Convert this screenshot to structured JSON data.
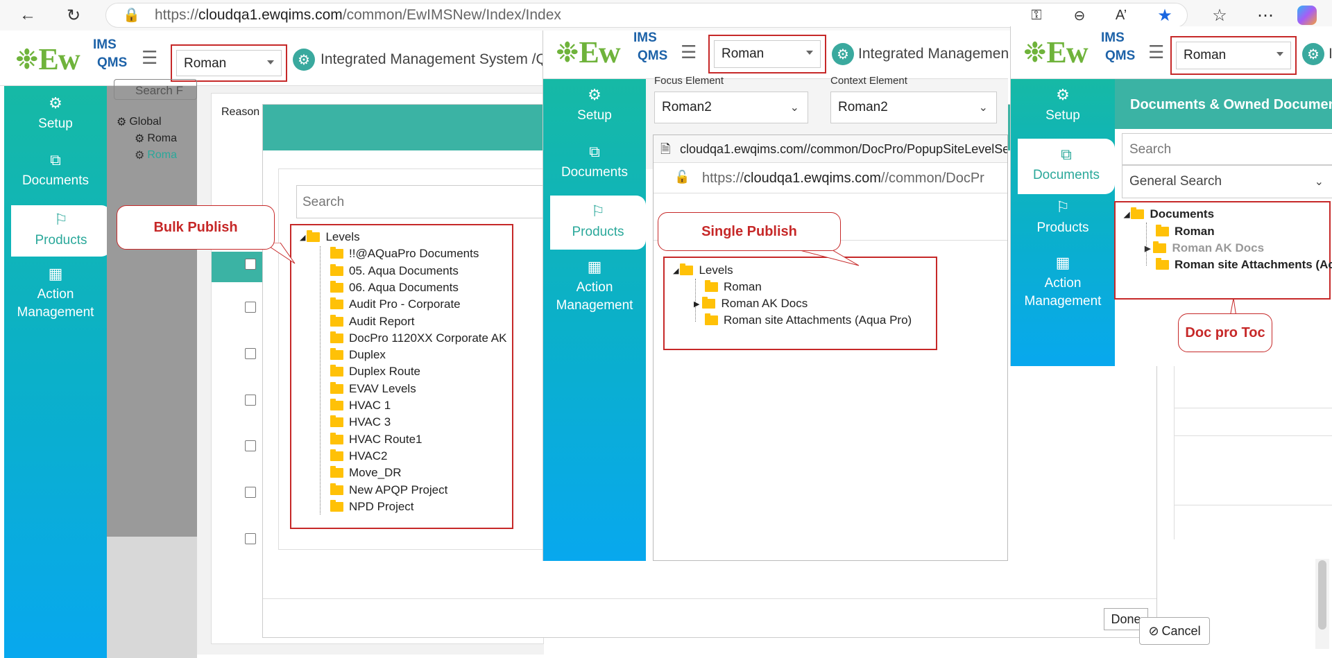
{
  "browser": {
    "url_prefix": "https://",
    "url_domain": "cloudqa1.ewqims.com",
    "url_path": "/common/EwIMSNew/Index/Index"
  },
  "logo": {
    "ew": "Ew",
    "ims": "IMS",
    "qms": "QMS"
  },
  "panel1": {
    "site_select": "Roman",
    "app_title": "Integrated Management System /Q",
    "nav": [
      {
        "label": "Setup",
        "icon": "gears-icon"
      },
      {
        "label": "Documents",
        "icon": "documents-icon"
      },
      {
        "label": "Products",
        "icon": "products-icon"
      },
      {
        "label": "Action Management",
        "icon": "building-icon"
      }
    ],
    "search_placeholder": "Search F",
    "tree": [
      {
        "label": "Global",
        "level": 0
      },
      {
        "label": "Roma",
        "level": 1
      },
      {
        "label": "Roma",
        "level": 1
      }
    ],
    "column_header": "Reason",
    "dialog": {
      "search_placeholder": "Search",
      "tree_root": "Levels",
      "items": [
        "!!@AQuaPro Documents",
        "05. Aqua Documents",
        "06. Aqua Documents",
        "Audit Pro - Corporate",
        "Audit Report",
        "DocPro 1120XX Corporate AK",
        "Duplex",
        "Duplex Route",
        "EVAV Levels",
        "HVAC 1",
        "HVAC 3",
        "HVAC Route1",
        "HVAC2",
        "Move_DR",
        "New APQP Project",
        "NPD Project"
      ],
      "done_label": "Done",
      "cancel_label": "Cancel"
    },
    "callout": "Bulk Publish"
  },
  "panel2": {
    "site_select": "Roman",
    "app_title": "Integrated Managemen",
    "nav": [
      {
        "label": "Setup"
      },
      {
        "label": "Documents"
      },
      {
        "label": "Products"
      },
      {
        "label": "Action Management"
      }
    ],
    "focus_label": "Focus Element",
    "context_label": "Context Element",
    "focus_value": "Roman2",
    "context_value": "Roman2",
    "popup_title": "cloudqa1.ewqims.com//common/DocPro/PopupSiteLevelSe",
    "popup_url_prefix": "https://",
    "popup_url_domain": "cloudqa1.ewqims.com",
    "popup_url_path": "//common/DocPr",
    "tree_root": "Levels",
    "items": [
      "Roman",
      "Roman AK Docs",
      "Roman site Attachments (Aqua Pro)"
    ],
    "callout": "Single Publish"
  },
  "panel3": {
    "site_select": "Roman",
    "app_title": "I",
    "nav": [
      {
        "label": "Setup"
      },
      {
        "label": "Documents"
      },
      {
        "label": "Products"
      },
      {
        "label": "Action Management"
      }
    ],
    "header": "Documents & Owned Documen",
    "search_placeholder": "Search",
    "search_type": "General Search",
    "tree_root": "Documents",
    "items": [
      "Roman",
      "Roman AK Docs",
      "Roman site Attachments (Ac"
    ],
    "callout": "Doc pro Toc"
  }
}
